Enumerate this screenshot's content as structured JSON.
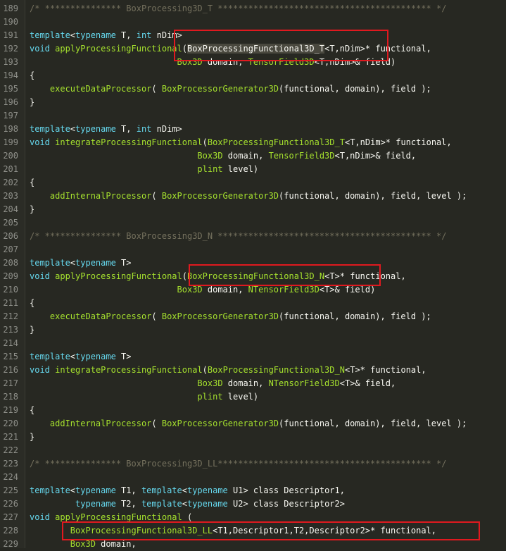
{
  "lines": [
    {
      "n": "189",
      "t": [
        [
          "cm",
          "/* *************** BoxProcessing3D_T ****************************************** */"
        ]
      ]
    },
    {
      "n": "190",
      "t": []
    },
    {
      "n": "191",
      "t": [
        [
          "kw",
          "template"
        ],
        [
          "op",
          "<"
        ],
        [
          "kw",
          "typename"
        ],
        [
          "var",
          " T, "
        ],
        [
          "kw",
          "int"
        ],
        [
          "var",
          " nDim"
        ],
        [
          "op",
          ">"
        ]
      ]
    },
    {
      "n": "192",
      "t": [
        [
          "kw",
          "void"
        ],
        [
          "var",
          " "
        ],
        [
          "fn",
          "applyProcessingFunctional"
        ],
        [
          "op",
          "("
        ],
        [
          "sel",
          "BoxProcessingFunctional3D_T"
        ],
        [
          "op",
          "<"
        ],
        [
          "var",
          "T,nDim"
        ],
        [
          "op",
          ">"
        ],
        [
          "var",
          "* functional,"
        ]
      ]
    },
    {
      "n": "193",
      "t": [
        [
          "var",
          "                             "
        ],
        [
          "type",
          "Box3D"
        ],
        [
          "var",
          " domain, "
        ],
        [
          "type",
          "TensorField3D"
        ],
        [
          "op",
          "<"
        ],
        [
          "var",
          "T,nDim"
        ],
        [
          "op",
          ">"
        ],
        [
          "var",
          "& field)"
        ]
      ]
    },
    {
      "n": "194",
      "t": [
        [
          "var",
          "{"
        ]
      ]
    },
    {
      "n": "195",
      "t": [
        [
          "var",
          "    "
        ],
        [
          "fn",
          "executeDataProcessor"
        ],
        [
          "var",
          "( "
        ],
        [
          "type",
          "BoxProcessorGenerator3D"
        ],
        [
          "var",
          "(functional, domain), field );"
        ]
      ]
    },
    {
      "n": "196",
      "t": [
        [
          "var",
          "}"
        ]
      ]
    },
    {
      "n": "197",
      "t": []
    },
    {
      "n": "198",
      "t": [
        [
          "kw",
          "template"
        ],
        [
          "op",
          "<"
        ],
        [
          "kw",
          "typename"
        ],
        [
          "var",
          " T, "
        ],
        [
          "kw",
          "int"
        ],
        [
          "var",
          " nDim"
        ],
        [
          "op",
          ">"
        ]
      ]
    },
    {
      "n": "199",
      "t": [
        [
          "kw",
          "void"
        ],
        [
          "var",
          " "
        ],
        [
          "fn",
          "integrateProcessingFunctional"
        ],
        [
          "op",
          "("
        ],
        [
          "type",
          "BoxProcessingFunctional3D_T"
        ],
        [
          "op",
          "<"
        ],
        [
          "var",
          "T,nDim"
        ],
        [
          "op",
          ">"
        ],
        [
          "var",
          "* functional,"
        ]
      ]
    },
    {
      "n": "200",
      "t": [
        [
          "var",
          "                                 "
        ],
        [
          "type",
          "Box3D"
        ],
        [
          "var",
          " domain, "
        ],
        [
          "type",
          "TensorField3D"
        ],
        [
          "op",
          "<"
        ],
        [
          "var",
          "T,nDim"
        ],
        [
          "op",
          ">"
        ],
        [
          "var",
          "& field,"
        ]
      ]
    },
    {
      "n": "201",
      "t": [
        [
          "var",
          "                                 "
        ],
        [
          "type",
          "plint"
        ],
        [
          "var",
          " level)"
        ]
      ]
    },
    {
      "n": "202",
      "t": [
        [
          "var",
          "{"
        ]
      ]
    },
    {
      "n": "203",
      "t": [
        [
          "var",
          "    "
        ],
        [
          "fn",
          "addInternalProcessor"
        ],
        [
          "var",
          "( "
        ],
        [
          "type",
          "BoxProcessorGenerator3D"
        ],
        [
          "var",
          "(functional, domain), field, level );"
        ]
      ]
    },
    {
      "n": "204",
      "t": [
        [
          "var",
          "}"
        ]
      ]
    },
    {
      "n": "205",
      "t": []
    },
    {
      "n": "206",
      "t": [
        [
          "cm",
          "/* *************** BoxProcessing3D_N ****************************************** */"
        ]
      ]
    },
    {
      "n": "207",
      "t": []
    },
    {
      "n": "208",
      "t": [
        [
          "kw",
          "template"
        ],
        [
          "op",
          "<"
        ],
        [
          "kw",
          "typename"
        ],
        [
          "var",
          " T"
        ],
        [
          "op",
          ">"
        ]
      ]
    },
    {
      "n": "209",
      "t": [
        [
          "kw",
          "void"
        ],
        [
          "var",
          " "
        ],
        [
          "fn",
          "applyProcessingFunctional"
        ],
        [
          "op",
          "("
        ],
        [
          "type",
          "BoxProcessingFunctional3D_N"
        ],
        [
          "op",
          "<"
        ],
        [
          "var",
          "T"
        ],
        [
          "op",
          ">"
        ],
        [
          "var",
          "* functional,"
        ]
      ]
    },
    {
      "n": "210",
      "t": [
        [
          "var",
          "                             "
        ],
        [
          "type",
          "Box3D"
        ],
        [
          "var",
          " domain, "
        ],
        [
          "type",
          "NTensorField3D"
        ],
        [
          "op",
          "<"
        ],
        [
          "var",
          "T"
        ],
        [
          "op",
          ">"
        ],
        [
          "var",
          "& field)"
        ]
      ]
    },
    {
      "n": "211",
      "t": [
        [
          "var",
          "{"
        ]
      ]
    },
    {
      "n": "212",
      "t": [
        [
          "var",
          "    "
        ],
        [
          "fn",
          "executeDataProcessor"
        ],
        [
          "var",
          "( "
        ],
        [
          "type",
          "BoxProcessorGenerator3D"
        ],
        [
          "var",
          "(functional, domain), field );"
        ]
      ]
    },
    {
      "n": "213",
      "t": [
        [
          "var",
          "}"
        ]
      ]
    },
    {
      "n": "214",
      "t": []
    },
    {
      "n": "215",
      "t": [
        [
          "kw",
          "template"
        ],
        [
          "op",
          "<"
        ],
        [
          "kw",
          "typename"
        ],
        [
          "var",
          " T"
        ],
        [
          "op",
          ">"
        ]
      ]
    },
    {
      "n": "216",
      "t": [
        [
          "kw",
          "void"
        ],
        [
          "var",
          " "
        ],
        [
          "fn",
          "integrateProcessingFunctional"
        ],
        [
          "op",
          "("
        ],
        [
          "type",
          "BoxProcessingFunctional3D_N"
        ],
        [
          "op",
          "<"
        ],
        [
          "var",
          "T"
        ],
        [
          "op",
          ">"
        ],
        [
          "var",
          "* functional,"
        ]
      ]
    },
    {
      "n": "217",
      "t": [
        [
          "var",
          "                                 "
        ],
        [
          "type",
          "Box3D"
        ],
        [
          "var",
          " domain, "
        ],
        [
          "type",
          "NTensorField3D"
        ],
        [
          "op",
          "<"
        ],
        [
          "var",
          "T"
        ],
        [
          "op",
          ">"
        ],
        [
          "var",
          "& field,"
        ]
      ]
    },
    {
      "n": "218",
      "t": [
        [
          "var",
          "                                 "
        ],
        [
          "type",
          "plint"
        ],
        [
          "var",
          " level)"
        ]
      ]
    },
    {
      "n": "219",
      "t": [
        [
          "var",
          "{"
        ]
      ]
    },
    {
      "n": "220",
      "t": [
        [
          "var",
          "    "
        ],
        [
          "fn",
          "addInternalProcessor"
        ],
        [
          "var",
          "( "
        ],
        [
          "type",
          "BoxProcessorGenerator3D"
        ],
        [
          "var",
          "(functional, domain), field, level );"
        ]
      ]
    },
    {
      "n": "221",
      "t": [
        [
          "var",
          "}"
        ]
      ]
    },
    {
      "n": "222",
      "t": []
    },
    {
      "n": "223",
      "t": [
        [
          "cm",
          "/* *************** BoxProcessing3D_LL****************************************** */"
        ]
      ]
    },
    {
      "n": "224",
      "t": []
    },
    {
      "n": "225",
      "t": [
        [
          "kw",
          "template"
        ],
        [
          "op",
          "<"
        ],
        [
          "kw",
          "typename"
        ],
        [
          "var",
          " T1, "
        ],
        [
          "kw",
          "template"
        ],
        [
          "op",
          "<"
        ],
        [
          "kw",
          "typename"
        ],
        [
          "var",
          " U1"
        ],
        [
          "op",
          ">"
        ],
        [
          "var",
          " class Descriptor1,"
        ]
      ]
    },
    {
      "n": "226",
      "t": [
        [
          "var",
          "         "
        ],
        [
          "kw",
          "typename"
        ],
        [
          "var",
          " T2, "
        ],
        [
          "kw",
          "template"
        ],
        [
          "op",
          "<"
        ],
        [
          "kw",
          "typename"
        ],
        [
          "var",
          " U2"
        ],
        [
          "op",
          ">"
        ],
        [
          "var",
          " class Descriptor2"
        ],
        [
          "op",
          ">"
        ]
      ]
    },
    {
      "n": "227",
      "t": [
        [
          "kw",
          "void"
        ],
        [
          "var",
          " "
        ],
        [
          "fn",
          "applyProcessingFunctional"
        ],
        [
          "var",
          " ("
        ]
      ]
    },
    {
      "n": "228",
      "t": [
        [
          "var",
          "        "
        ],
        [
          "type",
          "BoxProcessingFunctional3D_LL"
        ],
        [
          "op",
          "<"
        ],
        [
          "var",
          "T1,Descriptor1,T2,Descriptor2"
        ],
        [
          "op",
          ">"
        ],
        [
          "var",
          "* functional,"
        ]
      ]
    },
    {
      "n": "229",
      "t": [
        [
          "var",
          "        "
        ],
        [
          "type",
          "Box3D"
        ],
        [
          "var",
          " domain,"
        ]
      ]
    }
  ]
}
